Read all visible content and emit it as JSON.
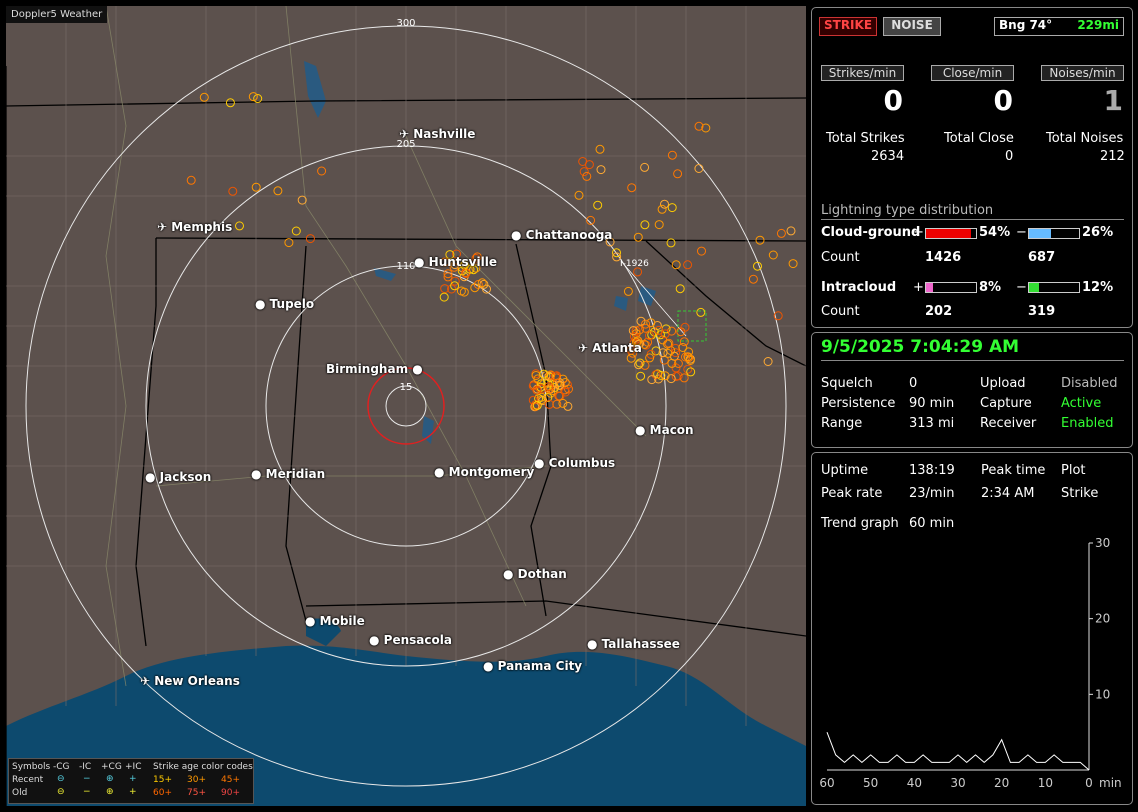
{
  "map": {
    "title": "Doppler5 Weather",
    "rings": [
      "300",
      "205",
      "110",
      "15"
    ],
    "cities": [
      {
        "name": "Nashville",
        "kind": "airport"
      },
      {
        "name": "Memphis",
        "kind": "airport"
      },
      {
        "name": "Chattanooga",
        "kind": "dot"
      },
      {
        "name": "Huntsville",
        "kind": "dot"
      },
      {
        "name": "Tupelo",
        "kind": "dot"
      },
      {
        "name": "Atlanta",
        "kind": "airport"
      },
      {
        "name": "Birmingham",
        "kind": "dot"
      },
      {
        "name": "Macon",
        "kind": "dot"
      },
      {
        "name": "Jackson",
        "kind": "dot"
      },
      {
        "name": "Meridian",
        "kind": "dot"
      },
      {
        "name": "Montgomery",
        "kind": "dot"
      },
      {
        "name": "Columbus",
        "kind": "dot"
      },
      {
        "name": "Dothan",
        "kind": "dot"
      },
      {
        "name": "Mobile",
        "kind": "dot"
      },
      {
        "name": "Pensacola",
        "kind": "dot"
      },
      {
        "name": "Tallahassee",
        "kind": "dot"
      },
      {
        "name": "Panama City",
        "kind": "dot"
      },
      {
        "name": "New Orleans",
        "kind": "airport"
      }
    ],
    "strike_marker": "I-1926",
    "legend": {
      "symbols": "Symbols",
      "cg_minus": "-CG",
      "ic_minus": "-IC",
      "cg_plus": "+CG",
      "ic_plus": "+IC",
      "age_title": "Strike age color codes",
      "recent": "Recent",
      "old": "Old",
      "ages_recent": [
        "15+",
        "30+",
        "45+"
      ],
      "ages_old": [
        "60+",
        "75+",
        "90+"
      ]
    }
  },
  "top": {
    "strike": "STRIKE",
    "noise": "NOISE",
    "bearing": "Bng 74°",
    "distance": "229mi",
    "strikes_min_btn": "Strikes/min",
    "close_min_btn": "Close/min",
    "noises_min_btn": "Noises/min",
    "strikes_min": "0",
    "close_min": "0",
    "noises_min": "1",
    "total_strikes_lbl": "Total Strikes",
    "total_close_lbl": "Total Close",
    "total_noises_lbl": "Total Noises",
    "total_strikes": "2634",
    "total_close": "0",
    "total_noises": "212",
    "dist_title": "Lightning type distribution",
    "cg_label": "Cloud-ground",
    "ic_label": "Intracloud",
    "count_label": "Count",
    "plus": "+",
    "minus": "−",
    "cg_plus_pct": "54%",
    "cg_minus_pct": "26%",
    "cg_plus_count": "1426",
    "cg_minus_count": "687",
    "ic_plus_pct": "8%",
    "ic_minus_pct": "12%",
    "ic_plus_count": "202",
    "ic_minus_count": "319",
    "cg_plus_frac": 0.54,
    "cg_minus_frac": 0.26,
    "ic_plus_frac": 0.08,
    "ic_minus_frac": 0.12
  },
  "status": {
    "datetime": "9/5/2025 7:04:29 AM",
    "squelch_lbl": "Squelch",
    "squelch": "0",
    "upload_lbl": "Upload",
    "upload": "Disabled",
    "persistence_lbl": "Persistence",
    "persistence": "90 min",
    "capture_lbl": "Capture",
    "capture": "Active",
    "range_lbl": "Range",
    "range": "313 mi",
    "receiver_lbl": "Receiver",
    "receiver": "Enabled"
  },
  "trend": {
    "uptime_lbl": "Uptime",
    "uptime": "138:19",
    "peak_time_lbl": "Peak time",
    "plot_lbl": "Plot",
    "peak_rate_lbl": "Peak rate",
    "peak_rate": "23/min",
    "peak_time": "2:34 AM",
    "plot": "Strike",
    "trend_graph_lbl": "Trend graph",
    "trend_graph": "60 min",
    "y_ticks": [
      "30",
      "20",
      "10"
    ],
    "x_ticks": [
      "60",
      "50",
      "40",
      "30",
      "20",
      "10",
      "0"
    ],
    "x_unit": "min"
  },
  "chart_data": {
    "type": "line",
    "x": [
      60,
      58,
      56,
      54,
      52,
      50,
      48,
      46,
      44,
      42,
      40,
      38,
      36,
      34,
      32,
      30,
      28,
      26,
      24,
      22,
      20,
      18,
      16,
      14,
      12,
      10,
      8,
      6,
      4,
      2,
      0
    ],
    "series": [
      {
        "values": [
          5,
          2,
          1,
          2,
          1,
          2,
          1,
          1,
          2,
          1,
          1,
          2,
          1,
          1,
          1,
          2,
          1,
          2,
          1,
          2,
          4,
          1,
          1,
          2,
          1,
          1,
          2,
          1,
          1,
          1,
          0
        ]
      }
    ],
    "ylim": [
      0,
      30
    ],
    "xlim": [
      60,
      0
    ]
  }
}
